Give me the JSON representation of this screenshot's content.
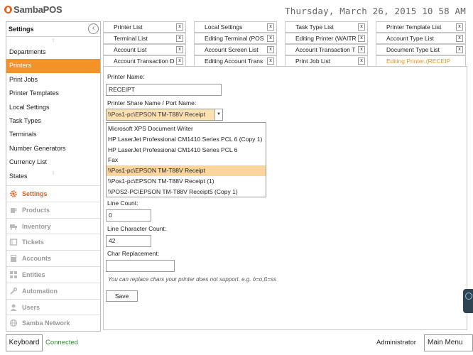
{
  "app": {
    "logo_sambapos": "SambaPOS"
  },
  "header": {
    "datetime": "Thursday, March 26, 2015 10 58 AM"
  },
  "nav": {
    "title": "Settings",
    "items": [
      {
        "label": "Departments",
        "active": false
      },
      {
        "label": "Printers",
        "active": true
      },
      {
        "label": "Print Jobs",
        "active": false
      },
      {
        "label": "Printer Templates",
        "active": false
      },
      {
        "label": "Local Settings",
        "active": false
      },
      {
        "label": "Task Types",
        "active": false
      },
      {
        "label": "Terminals",
        "active": false
      },
      {
        "label": "Number Generators",
        "active": false
      },
      {
        "label": "Currency List",
        "active": false
      },
      {
        "label": "States",
        "active": false
      }
    ],
    "sections": [
      {
        "label": "Settings",
        "icon": "gear-icon",
        "active": true
      },
      {
        "label": "Products",
        "icon": "cup-icon",
        "active": false
      },
      {
        "label": "Inventory",
        "icon": "truck-icon",
        "active": false
      },
      {
        "label": "Tickets",
        "icon": "ticket-icon",
        "active": false
      },
      {
        "label": "Accounts",
        "icon": "calculator-icon",
        "active": false
      },
      {
        "label": "Entities",
        "icon": "grid-icon",
        "active": false
      },
      {
        "label": "Automation",
        "icon": "wrench-icon",
        "active": false
      },
      {
        "label": "Users",
        "icon": "user-icon",
        "active": false
      },
      {
        "label": "Samba Network",
        "icon": "globe-icon",
        "active": false
      }
    ]
  },
  "tabs": {
    "close_label": "x",
    "row1": [
      "Printer List",
      "Local Settings",
      "Task Type List",
      "Printer Template List"
    ],
    "row2": [
      "Terminal List",
      "Editing Terminal (POS",
      "Editing Printer (WAITR",
      "Account Type List"
    ],
    "row3": [
      "Account List",
      "Account Screen List",
      "Account Transaction T",
      "Document Type List"
    ],
    "row4": [
      "Account Transaction D",
      "Editing Account Trans",
      "Print Job List",
      "Editing Printer (RECEIP"
    ]
  },
  "form": {
    "printer_name_label": "Printer Name:",
    "printer_name_value": "RECEIPT",
    "share_name_label": "Printer Share Name / Port Name:",
    "share_name_value": "\\\\Pos1-pc\\EPSON TM-T88V Receipt",
    "dropdown_options": [
      {
        "label": "Microsoft XPS Document Writer",
        "selected": false
      },
      {
        "label": "HP LaserJet Professional CM1410 Series PCL 6 (Copy 1)",
        "selected": false
      },
      {
        "label": "HP LaserJet Professional CM1410 Series PCL 6",
        "selected": false
      },
      {
        "label": "Fax",
        "selected": false
      },
      {
        "label": "\\\\Pos1-pc\\EPSON TM-T88V Receipt",
        "selected": true
      },
      {
        "label": "\\\\Pos1-pc\\EPSON TM-T88V Receipt (1)",
        "selected": false
      },
      {
        "label": "\\\\POS2-PC\\EPSON TM-T88V Receipt5 (Copy 1)",
        "selected": false
      }
    ],
    "line_count_label": "Line Count:",
    "line_count_value": "0",
    "line_char_count_label": "Line Character Count:",
    "line_char_count_value": "42",
    "char_replacement_label": "Char Replacement:",
    "char_replacement_value": "",
    "hint": "You can replace chars your printer does not support. e.g. ó=o,ß=ss",
    "save_label": "Save"
  },
  "footer": {
    "keyboard_label": "Keyboard",
    "connection_status": "Connected",
    "user_name": "Administrator",
    "main_menu_label": "Main Menu"
  },
  "colors": {
    "accent": "#f39325",
    "logo": "#e8611c",
    "selected_option": "#fbd59e",
    "status_ok": "#2d8a2d"
  }
}
